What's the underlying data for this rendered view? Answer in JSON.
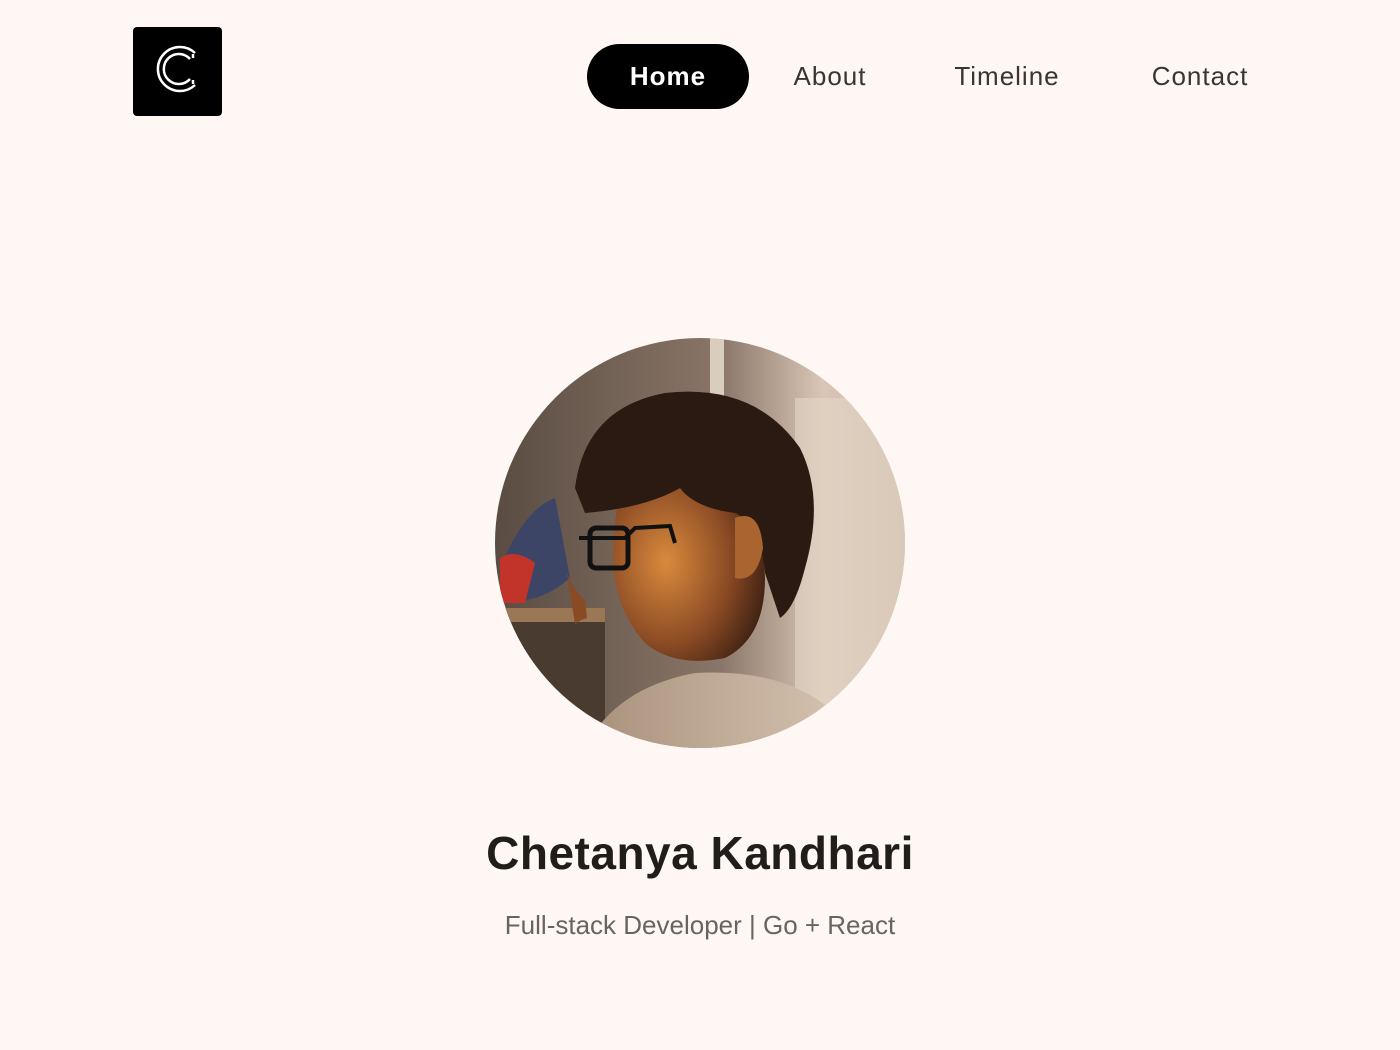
{
  "logo": {
    "letter": "C",
    "icon": "c-monogram-icon"
  },
  "nav": {
    "items": [
      {
        "label": "Home",
        "active": true
      },
      {
        "label": "About",
        "active": false
      },
      {
        "label": "Timeline",
        "active": false
      },
      {
        "label": "Contact",
        "active": false
      }
    ]
  },
  "profile": {
    "name": "Chetanya Kandhari",
    "tagline": "Full-stack Developer | Go + React",
    "photo": "profile-photo"
  },
  "colors": {
    "background": "#fff7f3",
    "accent": "#000000",
    "text": "#211d1b",
    "muted": "#6a6360"
  }
}
